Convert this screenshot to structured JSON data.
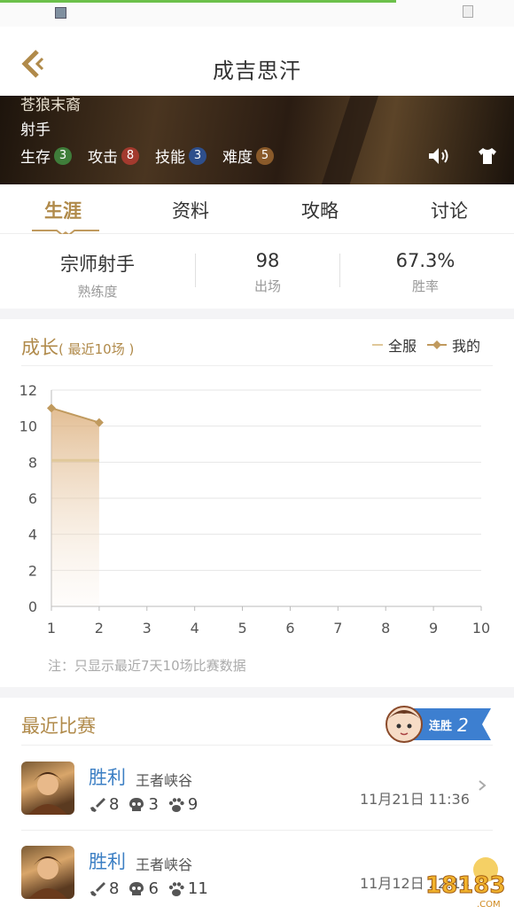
{
  "header": {
    "title": "成吉思汗"
  },
  "hero": {
    "subtitle": "苍狼末裔",
    "role": "射手",
    "stats": [
      {
        "label": "生存",
        "value": "3",
        "color": "#3f7d3a"
      },
      {
        "label": "攻击",
        "value": "8",
        "color": "#a33a2e"
      },
      {
        "label": "技能",
        "value": "3",
        "color": "#2e4f8c"
      },
      {
        "label": "难度",
        "value": "5",
        "color": "#8a5a2a"
      }
    ],
    "icons": {
      "sound": "sound-icon",
      "skin": "skin-shirt-icon"
    }
  },
  "tabs": [
    "生涯",
    "资料",
    "攻略",
    "讨论"
  ],
  "active_tab": "生涯",
  "summary": [
    {
      "value": "宗师射手",
      "label": "熟练度"
    },
    {
      "value": "98",
      "label": "出场"
    },
    {
      "value": "67.3%",
      "label": "胜率"
    }
  ],
  "growth": {
    "title": "成长",
    "subtitle": "( 最近10场 )",
    "note": "注：只显示最近7天10场比赛数据"
  },
  "chart_data": {
    "type": "line",
    "x": [
      1,
      2,
      3,
      4,
      5,
      6,
      7,
      8,
      9,
      10
    ],
    "xticks": [
      "1",
      "2",
      "3",
      "4",
      "5",
      "6",
      "7",
      "8",
      "9",
      "10"
    ],
    "yticks": [
      "0",
      "2",
      "4",
      "6",
      "8",
      "10",
      "12"
    ],
    "ylim": [
      0,
      12
    ],
    "xlim": [
      1,
      10
    ],
    "grid": true,
    "legend_position": "top-right",
    "series": [
      {
        "name": "全服",
        "x": [
          1,
          2
        ],
        "values": [
          8.1,
          8.1
        ],
        "color": "#e0c89a"
      },
      {
        "name": "我的",
        "x": [
          1,
          2
        ],
        "values": [
          11.0,
          10.2
        ],
        "color": "#c09a5e"
      }
    ]
  },
  "recent": {
    "title": "最近比赛",
    "streak_label": "连胜",
    "streak_count": "2",
    "matches": [
      {
        "result": "胜利",
        "mode": "王者峡谷",
        "kills": "8",
        "deaths": "3",
        "assists": "9",
        "time": "11月21日 11:36"
      },
      {
        "result": "胜利",
        "mode": "王者峡谷",
        "kills": "8",
        "deaths": "6",
        "assists": "11",
        "time": "11月12日 22:14"
      }
    ]
  },
  "watermark": {
    "text": "18183",
    "sub": ".COM"
  }
}
